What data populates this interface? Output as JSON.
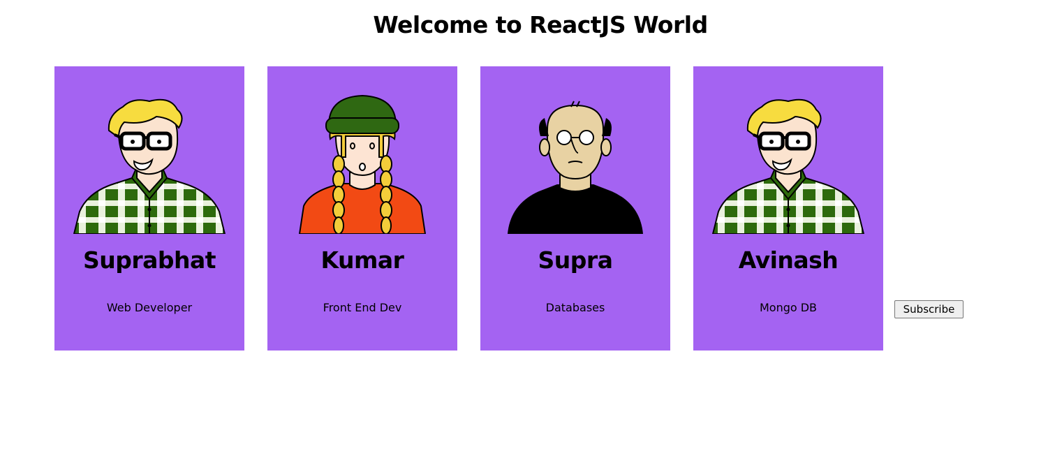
{
  "header": {
    "title": "Welcome to ReactJS World"
  },
  "cards": [
    {
      "name": "Suprabhat",
      "role": "Web Developer",
      "avatar": "nerd-glasses-avatar-icon"
    },
    {
      "name": "Kumar",
      "role": "Front End Dev",
      "avatar": "beanie-braids-avatar-icon"
    },
    {
      "name": "Supra",
      "role": "Databases",
      "avatar": "bald-old-man-avatar-icon"
    },
    {
      "name": "Avinash",
      "role": "Mongo DB",
      "avatar": "nerd-glasses-avatar-icon"
    }
  ],
  "subscribe": {
    "label": "Subscribe"
  },
  "colors": {
    "card_bg": "#a463f2",
    "page_bg": "#ffffff"
  }
}
